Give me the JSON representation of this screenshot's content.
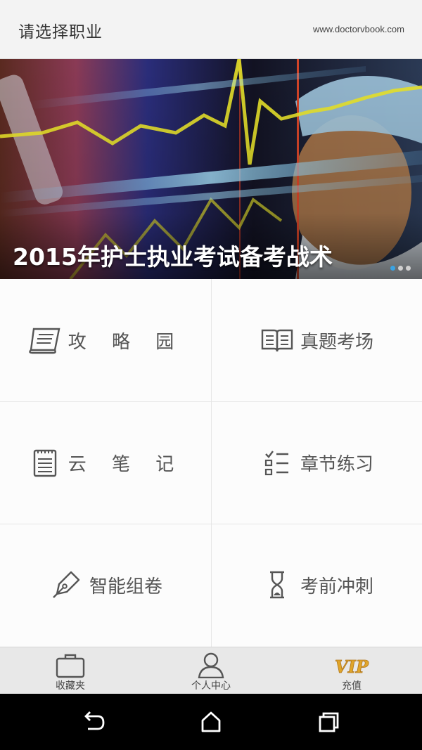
{
  "header": {
    "title": "请选择职业",
    "site": "www.doctorvbook.com"
  },
  "banner": {
    "caption": "2015年护士执业考试备考战术",
    "dots": 3,
    "active_dot": 0
  },
  "menu": [
    {
      "label": "攻 略 园",
      "icon": "scroll-icon"
    },
    {
      "label": "真题考场",
      "icon": "open-book-icon"
    },
    {
      "label": "云 笔 记",
      "icon": "notepad-icon"
    },
    {
      "label": "章节练习",
      "icon": "checklist-icon"
    },
    {
      "label": "智能组卷",
      "icon": "pen-nib-icon"
    },
    {
      "label": "考前冲刺",
      "icon": "hourglass-icon"
    }
  ],
  "tabs": [
    {
      "label": "收藏夹",
      "icon": "briefcase-icon"
    },
    {
      "label": "个人中心",
      "icon": "user-icon"
    },
    {
      "label": "充值",
      "icon": "vip-icon",
      "badge": "VIP"
    }
  ],
  "nav": {
    "back": "back-icon",
    "home": "home-icon",
    "recents": "recents-icon"
  },
  "colors": {
    "accent": "#3aa3e3",
    "vip": "#e0a52a"
  }
}
